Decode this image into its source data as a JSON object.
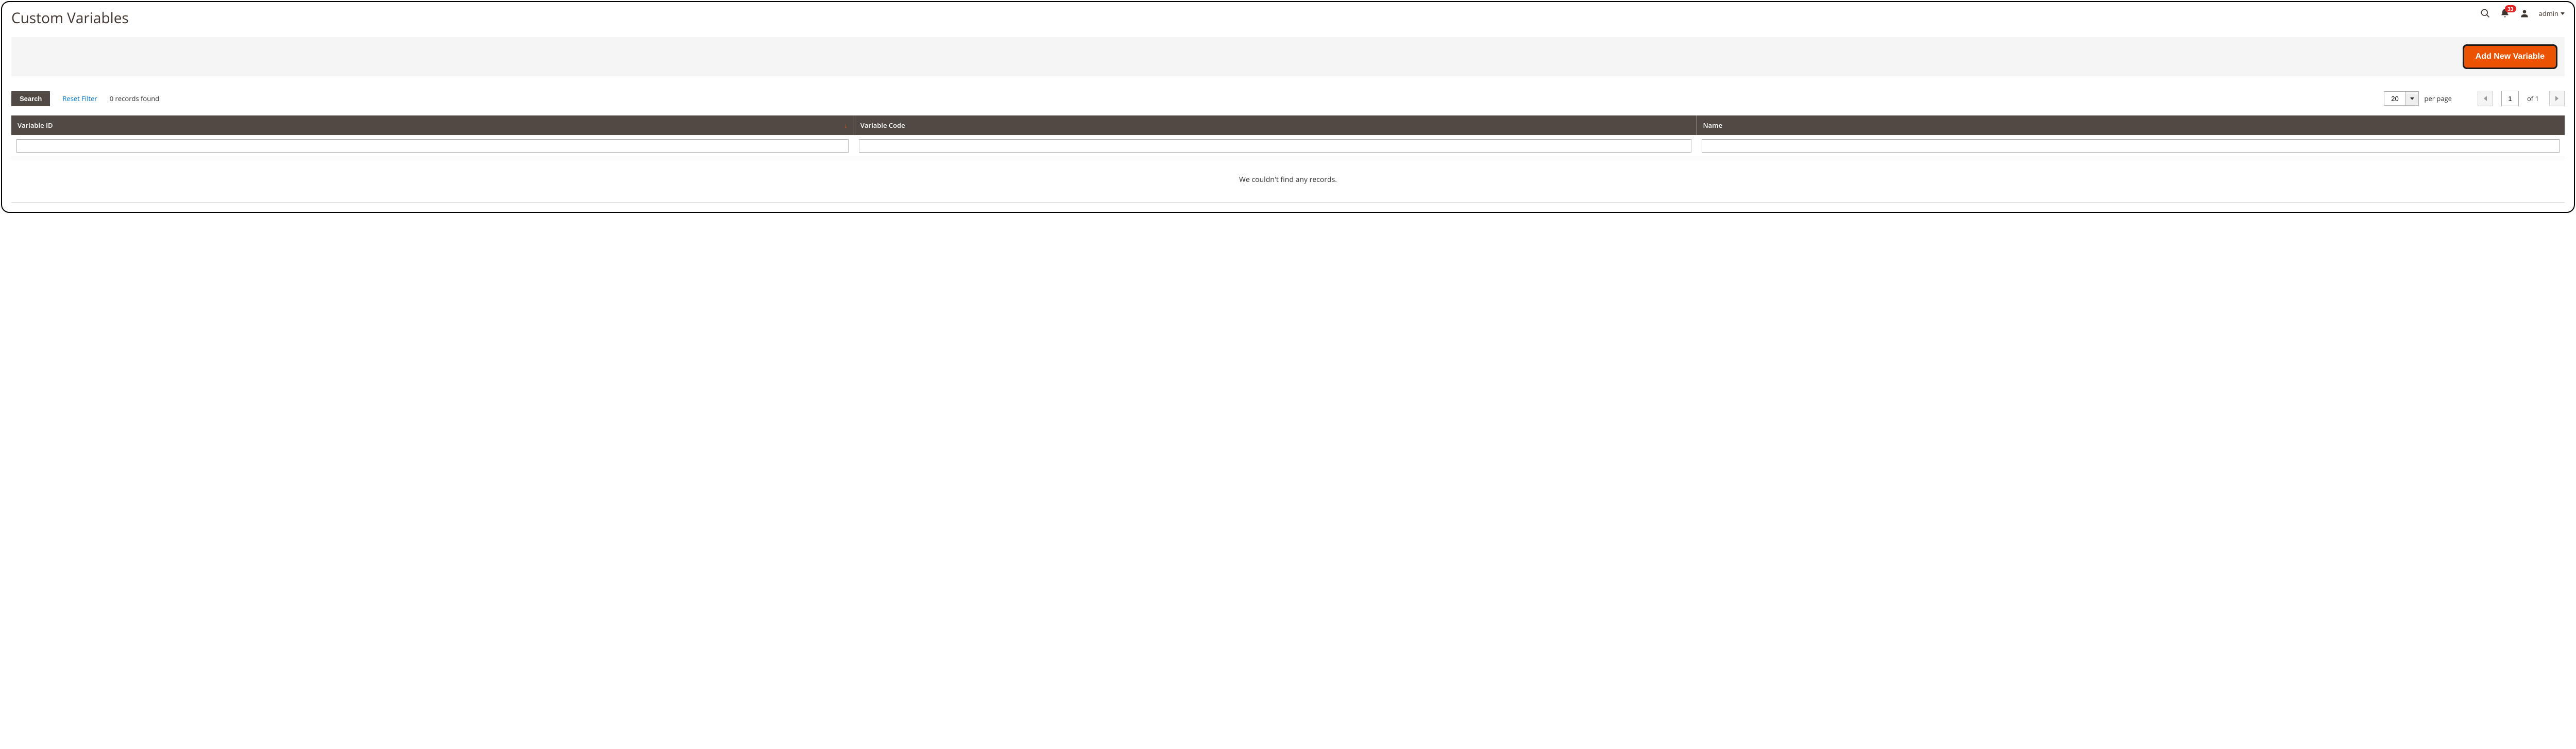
{
  "header": {
    "title": "Custom Variables",
    "notification_count": "33",
    "admin_user": "admin"
  },
  "actions": {
    "add_new_label": "Add New Variable"
  },
  "grid": {
    "search_label": "Search",
    "reset_label": "Reset Filter",
    "records_found": "0 records found",
    "page_size": "20",
    "per_page_label": "per page",
    "current_page": "1",
    "total_pages": "1",
    "of_label": "of",
    "columns": {
      "variable_id": "Variable ID",
      "variable_code": "Variable Code",
      "name": "Name"
    },
    "empty_message": "We couldn't find any records."
  }
}
